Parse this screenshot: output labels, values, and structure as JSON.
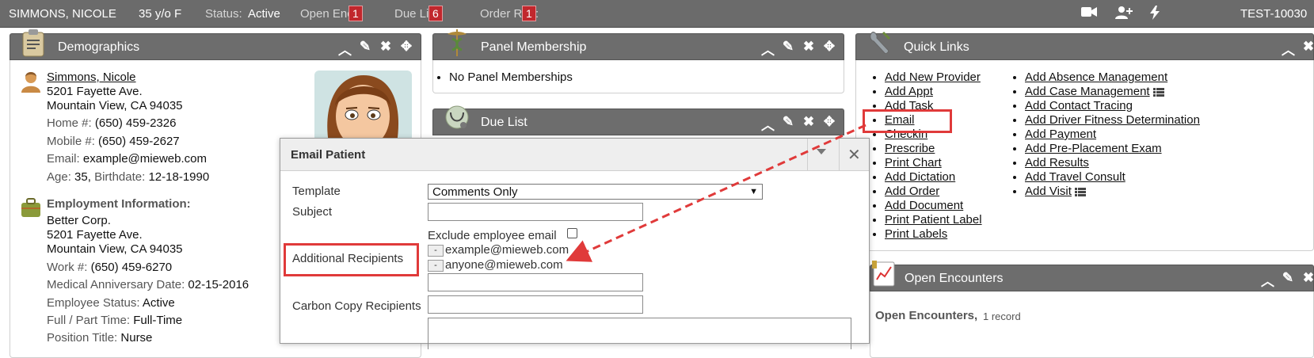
{
  "topbar": {
    "patient_name": "SIMMONS, NICOLE",
    "age_sex": "35 y/o F",
    "status_label": "Status:",
    "status_value": "Active",
    "open_enc_label": "Open Enc:",
    "open_enc_count": "1",
    "due_list_label": "Due List:",
    "due_list_count": "6",
    "order_req_label": "Order Req:",
    "order_req_count": "1",
    "patient_id": "TEST-10030",
    "icons": [
      "video-icon",
      "add-user-icon",
      "lightning-icon"
    ]
  },
  "demographics": {
    "title": "Demographics",
    "name": "Simmons, Nicole",
    "address1": "5201 Fayette Ave.",
    "address2": "Mountain View, CA 94035",
    "home_label": "Home #:",
    "home_value": "(650) 459-2326",
    "mobile_label": "Mobile #:",
    "mobile_value": "(650) 459-2627",
    "email_label": "Email:",
    "email_value": "example@mieweb.com",
    "age_label": "Age:",
    "age_value": "35,",
    "birthdate_label": "Birthdate:",
    "birthdate_value": "12-18-1990",
    "employment_title": "Employment Information:",
    "employer": "Better Corp.",
    "emp_address1": "5201 Fayette Ave.",
    "emp_address2": "Mountain View, CA 94035",
    "work_label": "Work #:",
    "work_value": "(650) 459-6270",
    "anniversary_label": "Medical Anniversary Date:",
    "anniversary_value": "02-15-2016",
    "emp_status_label": "Employee Status:",
    "emp_status_value": "Active",
    "fullpart_label": "Full / Part Time:",
    "fullpart_value": "Full-Time",
    "position_label": "Position Title:",
    "position_value": "Nurse"
  },
  "panel_membership": {
    "title": "Panel Membership",
    "items": [
      "No Panel Memberships"
    ]
  },
  "due_list": {
    "title": "Due List"
  },
  "quick_links": {
    "title": "Quick Links",
    "col1": [
      "Add New Provider",
      "Add Appt",
      "Add Task",
      "Email",
      "Checkin",
      "Prescribe",
      "Print Chart",
      "Add Dictation",
      "Add Order",
      "Add Document",
      "Print Patient Label",
      "Print Labels"
    ],
    "col2": [
      "Add Absence Management",
      "Add Case Management",
      "Add Contact Tracing",
      "Add Driver Fitness Determination",
      "Add Payment",
      "Add Pre-Placement Exam",
      "Add Results",
      "Add Travel Consult",
      "Add Visit"
    ]
  },
  "open_encounters": {
    "title": "Open Encounters",
    "summary_label": "Open Encounters,",
    "summary_count": "1 record"
  },
  "email_dialog": {
    "title": "Email Patient",
    "template_label": "Template",
    "template_value": "Comments Only",
    "subject_label": "Subject",
    "subject_value": "",
    "exclude_label": "Exclude employee email",
    "exclude_checked": false,
    "additional_label": "Additional Recipients",
    "recipients": [
      "example@mieweb.com",
      "anyone@mieweb.com"
    ],
    "remove_label": "-",
    "carbon_label": "Carbon Copy Recipients"
  },
  "colors": {
    "topbar_bg": "#6b6b6b",
    "panel_header_bg": "#6d6d6d",
    "badge_red": "#c1272d",
    "annotation_red": "#e03a3a"
  }
}
